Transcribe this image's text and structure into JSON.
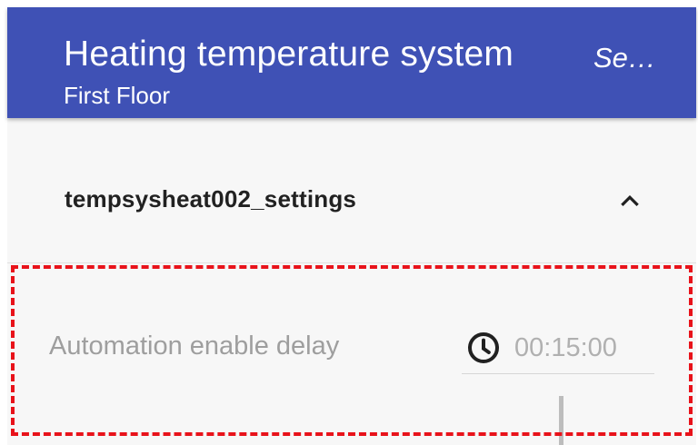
{
  "appbar": {
    "title": "Heating temperature system",
    "subtitle": "First Floor",
    "action_label": "Se…",
    "color": "#3f51b5"
  },
  "panel": {
    "title": "tempsysheat002_settings",
    "expanded_icon": "chevron-up-icon"
  },
  "settings": [
    {
      "label": "Automation enable delay",
      "icon": "clock-icon",
      "value": "00:15:00"
    }
  ],
  "highlight_color": "#e8121a"
}
